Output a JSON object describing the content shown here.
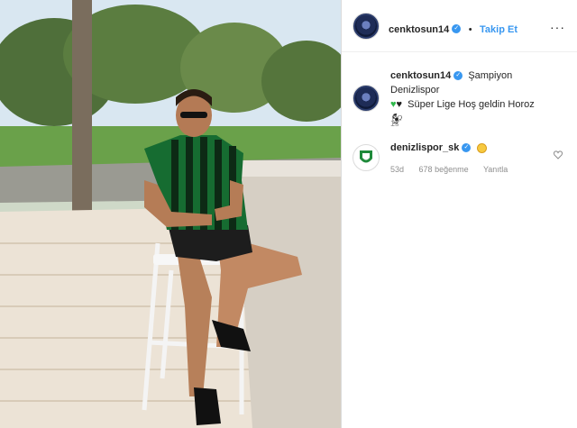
{
  "post": {
    "username": "cenktosun14",
    "follow_label": "Takip Et",
    "more_icon": "ellipsis-icon",
    "caption_line1": "Şampiyon Denizlispor",
    "caption_line2": "Süper Lige Hoş geldin Horoz",
    "caption_emojis": "green-heart, black-heart, rooster",
    "time": "1s"
  },
  "comment": {
    "username": "denizlispor_sk",
    "emoji": "smiling-face",
    "age": "53d",
    "likes": "678 beğenme",
    "reply": "Yanıtla"
  },
  "colors": {
    "accent": "#3897f0",
    "muted": "#8e8e8e",
    "jersey": "#1f8a3a"
  }
}
